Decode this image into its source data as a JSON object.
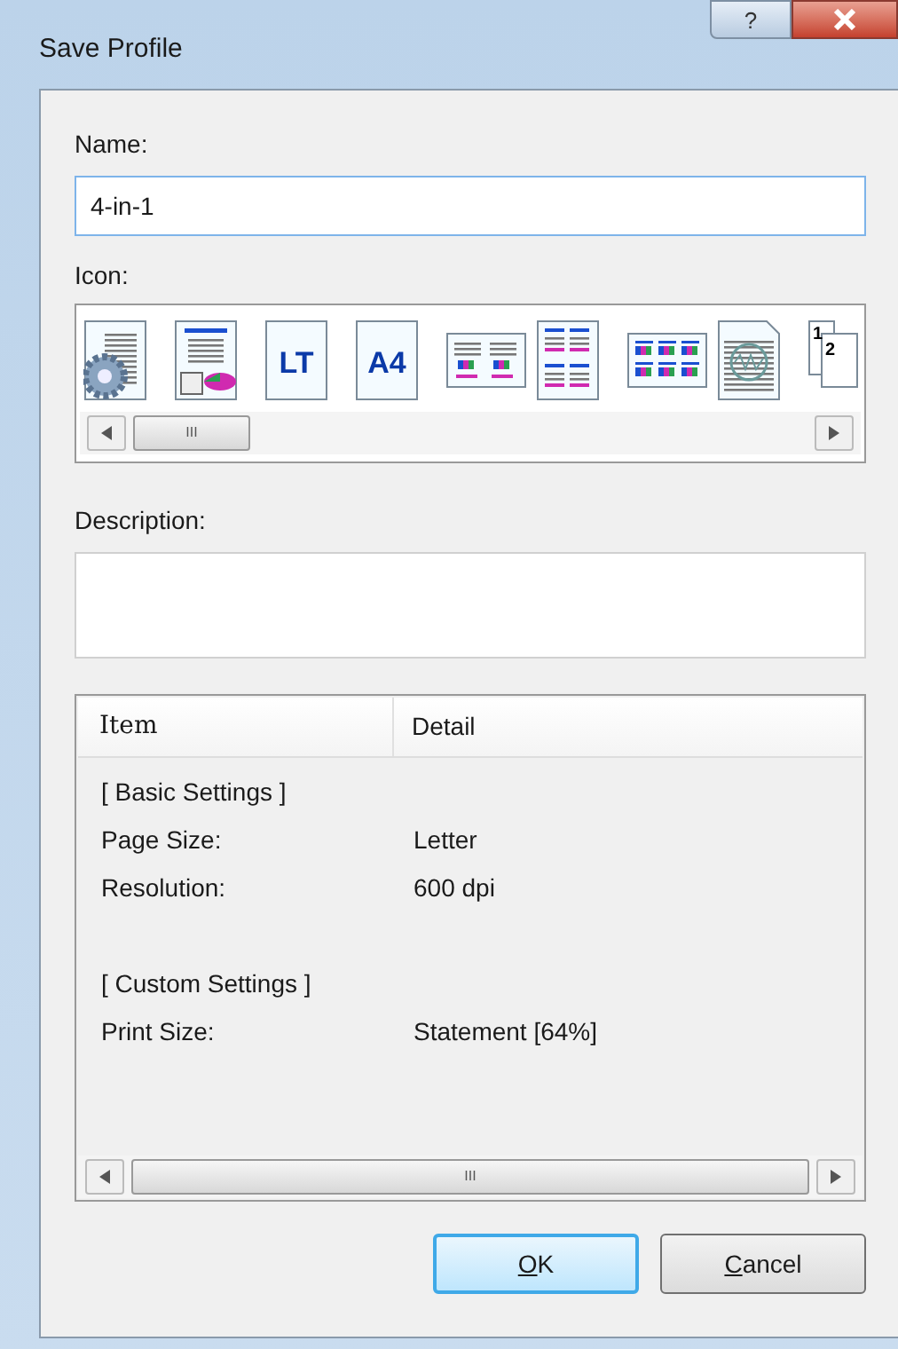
{
  "window": {
    "title": "Save Profile",
    "help": "?"
  },
  "name": {
    "label": "Name:",
    "value": "4-in-1"
  },
  "icon": {
    "label": "Icon:",
    "items": [
      {
        "kind": "settings"
      },
      {
        "kind": "chart"
      },
      {
        "kind": "paper",
        "label": "LT"
      },
      {
        "kind": "paper",
        "label": "A4"
      },
      {
        "kind": "two-up"
      },
      {
        "kind": "four-up"
      },
      {
        "kind": "six-up"
      },
      {
        "kind": "watermark"
      },
      {
        "kind": "pages",
        "labels": [
          "1",
          "2"
        ]
      }
    ],
    "scroll_grip": "III"
  },
  "description": {
    "label": "Description:"
  },
  "table": {
    "columns": [
      "Item",
      "Detail"
    ],
    "rows": [
      {
        "kind": "group",
        "item": "[ Basic Settings ]"
      },
      {
        "kind": "setting",
        "item": "Page Size:",
        "detail": "Letter"
      },
      {
        "kind": "setting",
        "item": "Resolution:",
        "detail": "600 dpi"
      },
      {
        "kind": "blank"
      },
      {
        "kind": "group",
        "item": "[ Custom Settings ]"
      },
      {
        "kind": "setting",
        "item": "Print Size:",
        "detail": "Statement [64%]"
      }
    ],
    "scroll_grip": "III"
  },
  "buttons": [
    {
      "mnemonic": "O",
      "rest": "K",
      "default": true
    },
    {
      "mnemonic": "C",
      "rest": "ancel",
      "default": false
    }
  ]
}
